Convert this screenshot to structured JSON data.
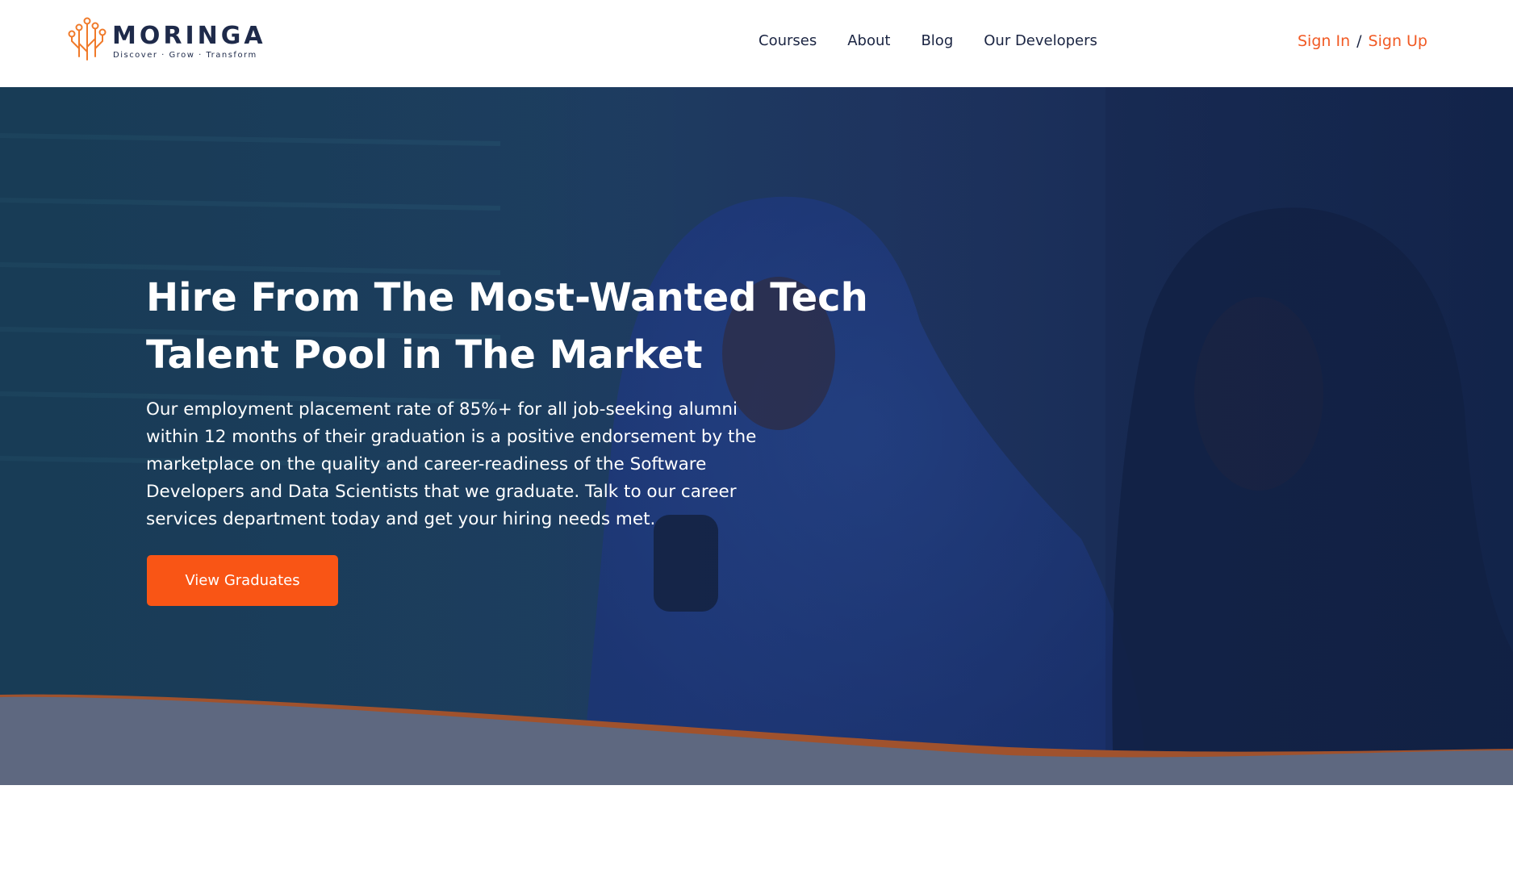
{
  "brand": {
    "name": "MORINGA",
    "tagline": "Discover · Grow · Transform"
  },
  "nav": {
    "items": [
      {
        "label": "Courses"
      },
      {
        "label": "About"
      },
      {
        "label": "Blog"
      },
      {
        "label": "Our Developers"
      }
    ]
  },
  "auth": {
    "sign_in": "Sign In",
    "separator": "/",
    "sign_up": "Sign Up"
  },
  "hero": {
    "title": "Hire From The Most-Wanted Tech Talent Pool in The Market",
    "text": "Our employment placement rate of 85%+ for all job-seeking alumni within 12 months of their graduation is a positive endorsement by the marketplace on the quality and career-readiness of the Software Developers and Data Scientists that we graduate. Talk to our career services department today and get your hiring needs met.",
    "cta_label": "View Graduates"
  },
  "colors": {
    "accent": "#f95515",
    "link": "#f15a24",
    "navy": "#1e2a4a",
    "hero_overlay": "#1a3358",
    "wave_band": "#5e6880",
    "wave_stripe": "#a0522d"
  }
}
